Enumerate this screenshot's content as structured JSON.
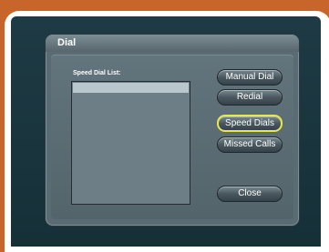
{
  "dialog": {
    "title": "Dial",
    "list_label": "Speed Dial List:",
    "buttons": {
      "manual_dial": "Manual Dial",
      "redial": "Redial",
      "speed_dials": "Speed Dials",
      "missed_calls": "Missed Calls",
      "close": "Close"
    }
  },
  "colors": {
    "background": "#c8652a",
    "screen": "#1e3a44",
    "dialog": "#5a6b73",
    "highlight_border": "#e8e84a",
    "arrow": "#f0a030"
  },
  "icons": {
    "pointer_arrow": "arrow-left-icon"
  }
}
